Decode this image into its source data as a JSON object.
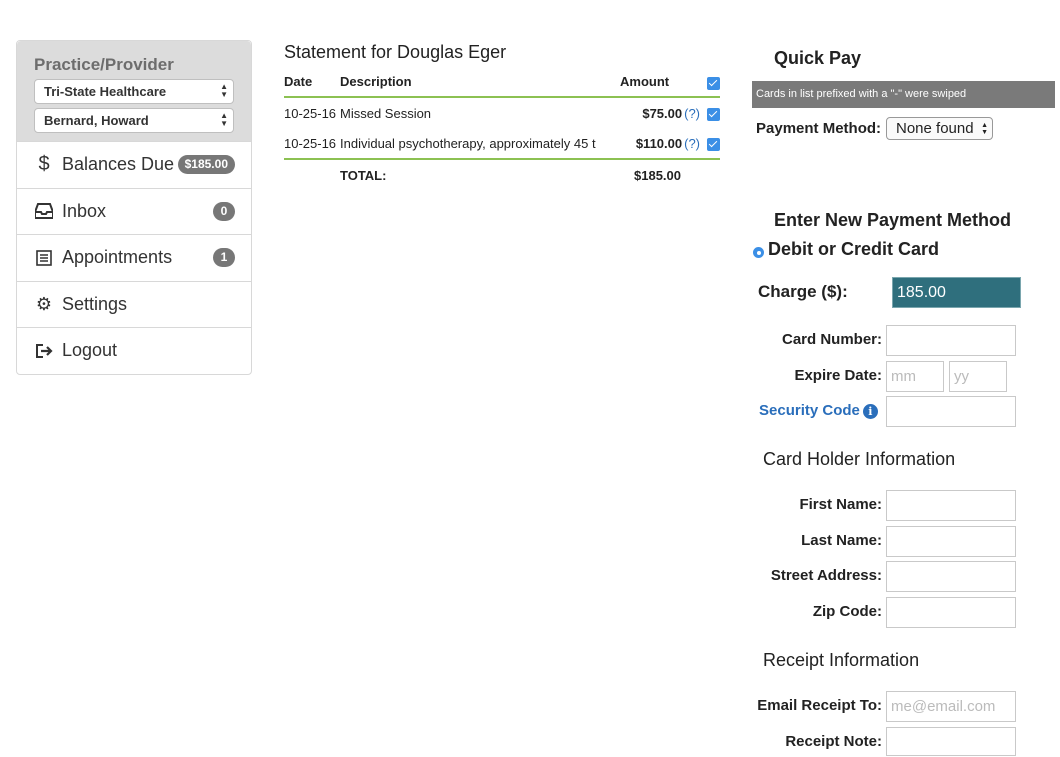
{
  "sidebar": {
    "title": "Practice/Provider",
    "practice_select": "Tri-State Healthcare",
    "provider_select": "Bernard, Howard",
    "items": [
      {
        "label": "Balances Due",
        "badge": "$185.00"
      },
      {
        "label": "Inbox",
        "badge": "0"
      },
      {
        "label": "Appointments",
        "badge": "1"
      },
      {
        "label": "Settings"
      },
      {
        "label": "Logout"
      }
    ]
  },
  "statement": {
    "title": "Statement for Douglas Eger",
    "headers": {
      "date": "Date",
      "description": "Description",
      "amount": "Amount"
    },
    "rows": [
      {
        "date": "10-25-16",
        "description": "Missed Session",
        "amount": "$75.00",
        "help": "(?)"
      },
      {
        "date": "10-25-16",
        "description": "Individual psychotherapy, approximately 45 t",
        "amount": "$110.00",
        "help": "(?)"
      }
    ],
    "total_label": "TOTAL:",
    "total_amount": "$185.00"
  },
  "quick_pay": {
    "title": "Quick Pay",
    "notice": "Cards in list prefixed with a \"-\" were swiped",
    "payment_method_label": "Payment Method:",
    "payment_method_value": "None found",
    "new_method_title": "Enter New Payment Method",
    "debit_label": "Debit or Credit Card",
    "charge_label": "Charge ($):",
    "charge_value": "185.00",
    "card_number_label": "Card Number:",
    "expire_label": "Expire Date:",
    "expire_mm_placeholder": "mm",
    "expire_yy_placeholder": "yy",
    "security_label": "Security Code",
    "card_holder_title": "Card Holder Information",
    "first_name_label": "First Name:",
    "last_name_label": "Last Name:",
    "street_label": "Street Address:",
    "zip_label": "Zip Code:",
    "receipt_title": "Receipt Information",
    "email_label": "Email Receipt To:",
    "email_placeholder": "me@email.com",
    "note_label": "Receipt Note:"
  },
  "colors": {
    "accent_green": "#8cc152",
    "charge_bg": "#2f6f7d",
    "checkbox_blue": "#3b8fe6",
    "link_blue": "#2a6ebb"
  }
}
